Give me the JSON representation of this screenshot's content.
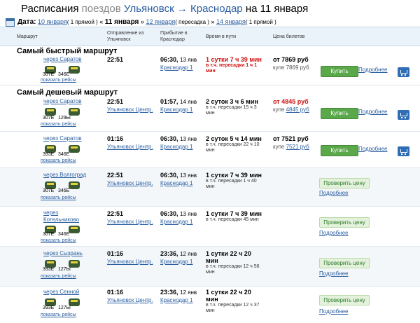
{
  "title": {
    "part1": "Расписания",
    "part2": "поездов",
    "from": "Ульяновск",
    "arrow": "→",
    "to": "Краснодар",
    "part3": "на 11 января"
  },
  "datebar": {
    "label": "Дата:",
    "d1": "10 января",
    "d1n": "( 1 прямой )",
    "sep1": "«",
    "d2": "11 января",
    "sep2": "»",
    "d3": "12 января",
    "d3n": "( пересадка )",
    "sep3": "»",
    "d4": "14 января",
    "d4n": "( 1 прямой )"
  },
  "header": {
    "route": "Маршрут",
    "dep": "Отправление из Ульяновск",
    "arr": "Прибытие в Краснодар",
    "dur": "Время в пути",
    "price": "Цена билетов"
  },
  "sections": {
    "fast": "Самый быстрый маршрут",
    "cheap": "Самый дешевый маршрут"
  },
  "common": {
    "buy": "Купить",
    "more": "Подробнее",
    "check": "Проверить цену",
    "show": "показать рейсы",
    "station_dep": "Ульяновск Центр.",
    "station_arr": "Краснодар 1",
    "kupe": "купе"
  },
  "rows": [
    {
      "via": "через Саратов",
      "t1": "307Е",
      "t2": "346Е",
      "dep": "22:51",
      "arr_time": "06:30,",
      "arr_date": "13 янв",
      "dur": "1 сутки 7 ч 39 мин",
      "dur_sub": "в т.ч. пересадки 1 ч 1 мин",
      "price": "от 7869 руб",
      "kupe": "7869 руб"
    },
    {
      "via": "через Саратов",
      "t1": "307Е",
      "t2": "129Ы",
      "dep": "22:51",
      "arr_time": "01:57,",
      "arr_date": "14 янв",
      "dur": "2 суток 3 ч 6 мин",
      "dur_sub": "в т.ч. пересадки 15 ч 3 мин",
      "price": "от 4845 руб",
      "kupe": "4845 руб"
    },
    {
      "via": "через Саратов",
      "t1": "393Е",
      "t2": "346Е",
      "dep": "01:16",
      "arr_time": "06:30,",
      "arr_date": "13 янв",
      "dur": "2 суток 5 ч 14 мин",
      "dur_sub": "в т.ч. пересадки 22 ч 10 мин",
      "price": "от 7521 руб",
      "kupe": "7521 руб"
    },
    {
      "via": "через Волгоград",
      "t1": "307Е",
      "t2": "346Е",
      "dep": "22:51",
      "arr_time": "06:30,",
      "arr_date": "13 янв",
      "dur": "1 сутки 7 ч 39 мин",
      "dur_sub": "в т.ч. пересадки 1 ч 40 мин"
    },
    {
      "via": "через Котельниково",
      "t1": "307Е",
      "t2": "346Е",
      "dep": "22:51",
      "arr_time": "06:30,",
      "arr_date": "13 янв",
      "dur": "1 сутки 7 ч 39 мин",
      "dur_sub": "в т.ч. пересадки 45 мин"
    },
    {
      "via": "через Сызрань",
      "t1": "393Е",
      "t2": "127Ы",
      "dep": "01:16",
      "arr_time": "23:36,",
      "arr_date": "12 янв",
      "dur": "1 сутки 22 ч 20 мин",
      "dur_sub": "в т.ч. пересадки 12 ч 56 мин"
    },
    {
      "via": "через Сенной",
      "t1": "393Е",
      "t2": "127Ы",
      "dep": "01:16",
      "arr_time": "23:36,",
      "arr_date": "12 янв",
      "dur": "1 сутки 22 ч 20 мин",
      "dur_sub": "в т.ч. пересадки 12 ч 37 мин"
    }
  ]
}
